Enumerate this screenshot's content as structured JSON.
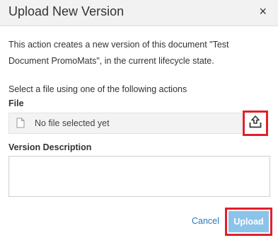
{
  "dialog": {
    "title": "Upload New Version",
    "close_label": "×"
  },
  "description": {
    "prefix": "This action creates a new version of this document \"",
    "doc_name": "Test Document PromoMats",
    "suffix": "\", in the current lifecycle state."
  },
  "instruction": "Select a file using one of the following actions",
  "file": {
    "label": "File",
    "placeholder": "No file selected yet",
    "icons": {
      "file": "file-icon",
      "upload": "upload-icon"
    }
  },
  "version_description": {
    "label": "Version Description",
    "value": ""
  },
  "actions": {
    "cancel_label": "Cancel",
    "upload_label": "Upload"
  },
  "colors": {
    "link": "#2a7ab8",
    "upload_button": "#8cc3ea",
    "highlight": "#e0202e"
  }
}
